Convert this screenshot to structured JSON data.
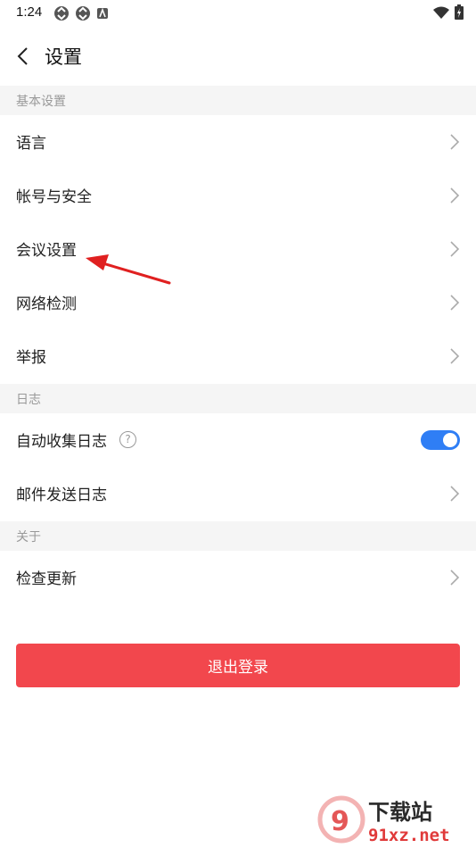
{
  "status_bar": {
    "time": "1:24"
  },
  "nav": {
    "title": "设置"
  },
  "sections": {
    "basic": "基本设置",
    "log": "日志",
    "about": "关于"
  },
  "rows": {
    "language": "语言",
    "account": "帐号与安全",
    "meeting": "会议设置",
    "network": "网络检测",
    "report": "举报",
    "auto_log": "自动收集日志",
    "mail_log": "邮件发送日志",
    "update": "检查更新"
  },
  "auto_log_enabled": true,
  "logout_label": "退出登录",
  "colors": {
    "accent": "#2f7ef5",
    "danger": "#f2474d",
    "annotation": "#e02020"
  },
  "watermark": {
    "brand": "下载站",
    "site": "91xz.net"
  }
}
